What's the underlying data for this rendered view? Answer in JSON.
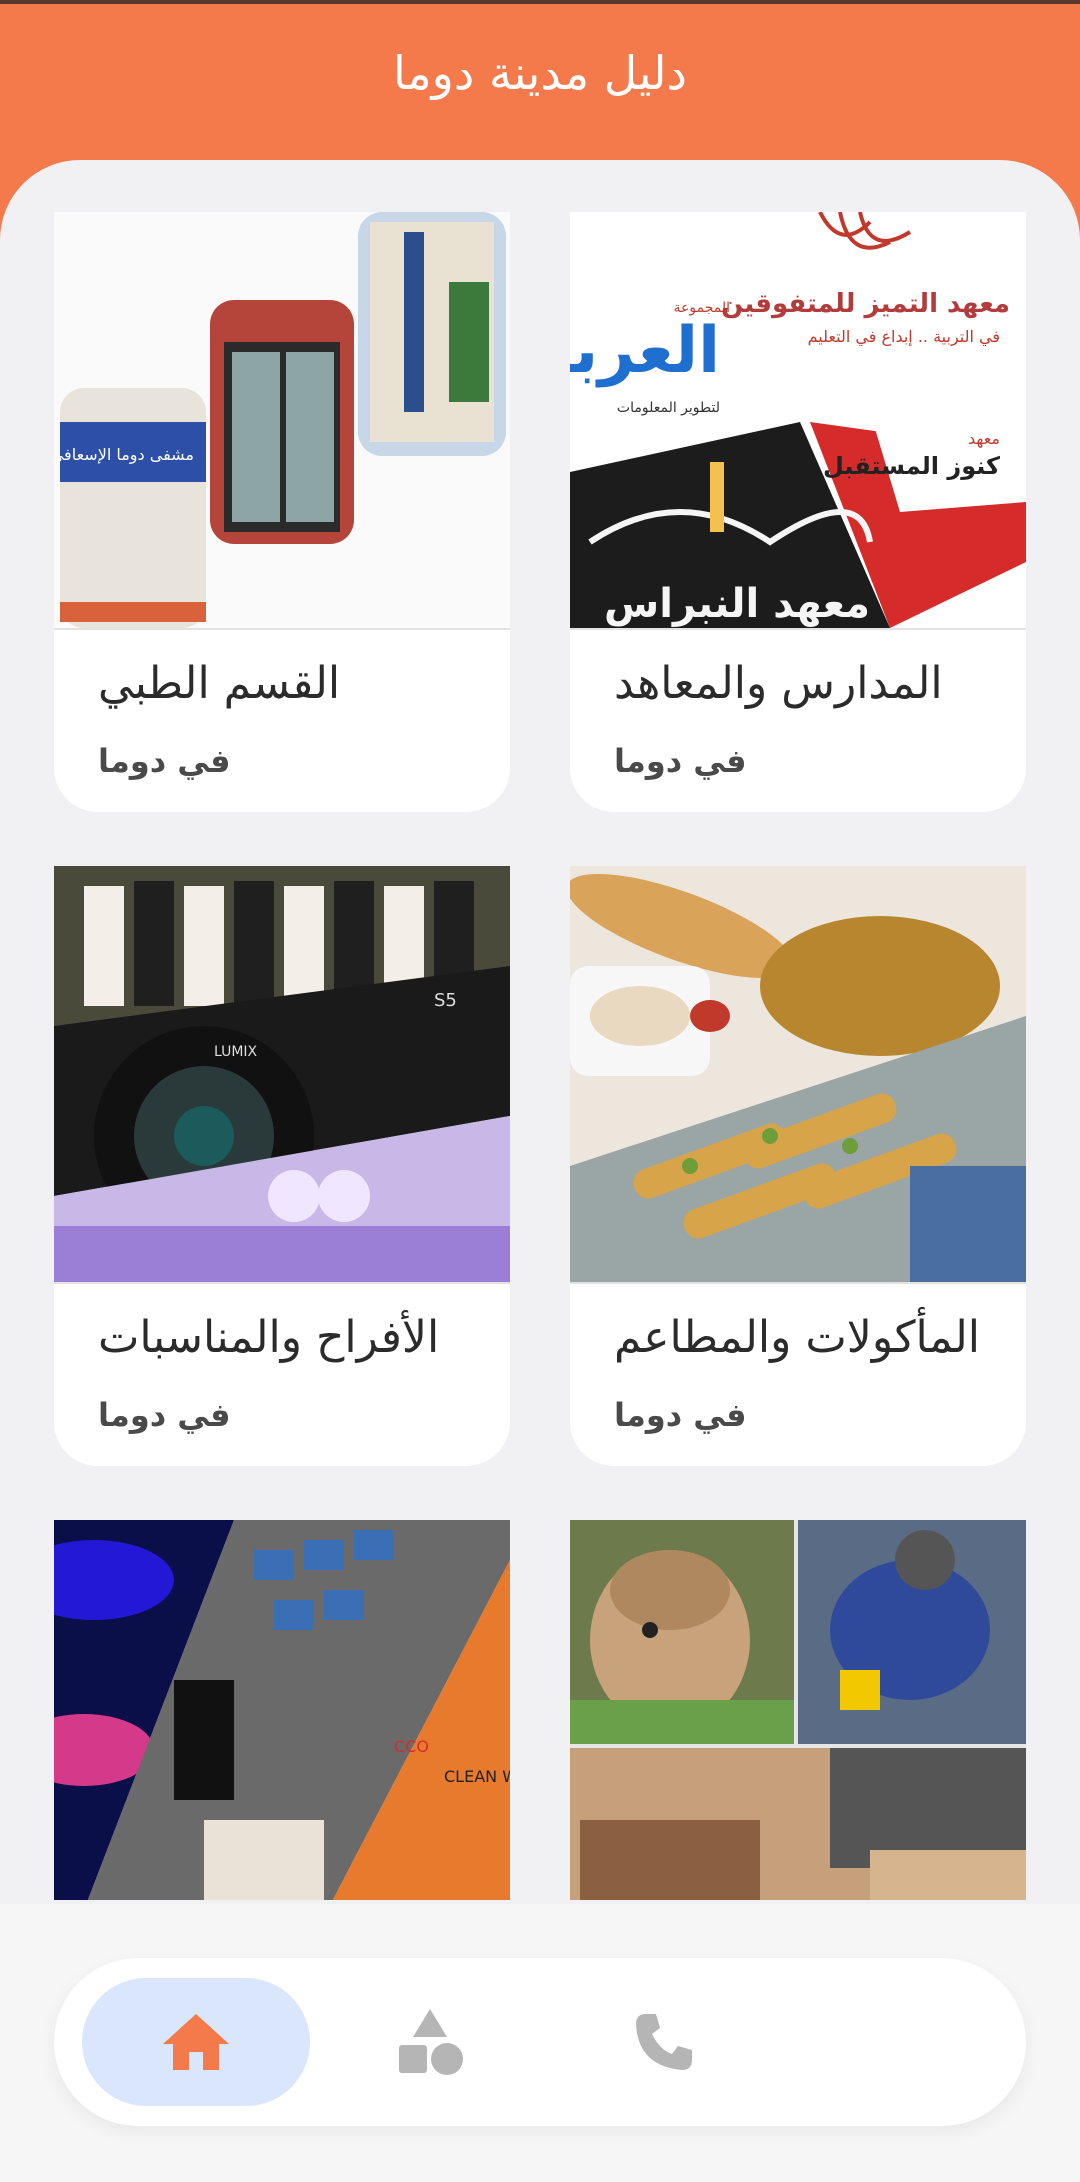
{
  "header": {
    "title": "دليل مدينة دوما"
  },
  "theme": {
    "accent": "#f47a4b",
    "nav_active_bg": "#d9e6fb",
    "icon_inactive": "#b5b5b5"
  },
  "categories": [
    {
      "title": "المدارس والمعاهد",
      "subtitle": "في دوما"
    },
    {
      "title": "القسم الطبي",
      "subtitle": "في دوما"
    },
    {
      "title": "المأكولات والمطاعم",
      "subtitle": "في دوما"
    },
    {
      "title": "الأفراح والمناسبات",
      "subtitle": "في دوما"
    },
    {
      "title": "",
      "subtitle": ""
    },
    {
      "title": "",
      "subtitle": ""
    }
  ],
  "image_texts": {
    "schools": [
      "معهد التميز للمتفوقين",
      "في التربية .. إبداع في التعليم",
      "المجموعة",
      "العربية",
      "لتطوير المعلومات",
      "معهد",
      "كنوز المستقبل",
      "معهد النبراس"
    ],
    "medical": [
      "مشفى دوما الإسعافي"
    ],
    "weddings": [
      "LUMIX",
      "S5"
    ],
    "hardware": [
      "CCO",
      "CLEAN W"
    ]
  },
  "bottom_nav": [
    {
      "name": "home",
      "icon": "home-icon",
      "active": true
    },
    {
      "name": "categories",
      "icon": "shapes-icon",
      "active": false
    },
    {
      "name": "contact",
      "icon": "phone-icon",
      "active": false
    }
  ]
}
